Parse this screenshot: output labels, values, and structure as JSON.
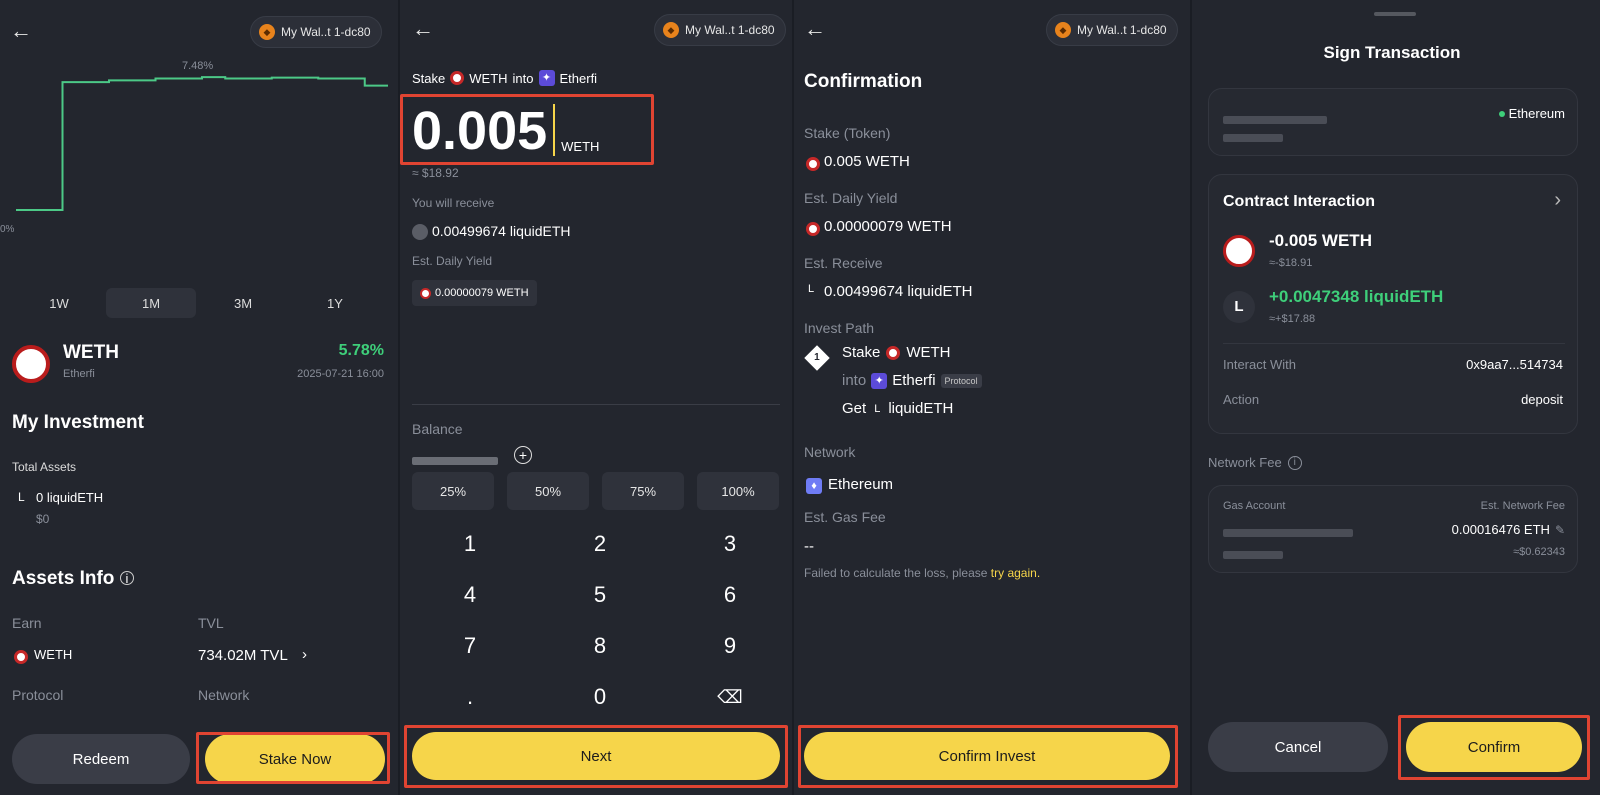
{
  "wallet_label": "My Wal..t 1-dc80",
  "p1": {
    "chart_peak_label": "7.48%",
    "chart_zero_label": "0%",
    "periods": [
      "1W",
      "1M",
      "3M",
      "1Y"
    ],
    "active_period": "1M",
    "token_name": "WETH",
    "token_protocol": "Etherfi",
    "apy": "5.78%",
    "timestamp": "2025-07-21 16:00",
    "my_investment_title": "My Investment",
    "total_assets_label": "Total Assets",
    "total_assets_amount": "0 liquidETH",
    "total_assets_usd": "$0",
    "assets_info_title": "Assets Info",
    "earn_label": "Earn",
    "earn_value": "WETH",
    "tvl_label": "TVL",
    "tvl_value": "734.02M TVL",
    "protocol_label": "Protocol",
    "network_label": "Network",
    "redeem_button": "Redeem",
    "stake_now_button": "Stake Now",
    "chart_points": [
      0,
      0,
      7.2,
      7.2,
      7.3,
      7.3,
      7.4,
      7.4,
      7.48,
      7.4,
      7.4,
      7.45,
      7.45,
      7.4,
      7.4,
      7.0,
      7.0
    ]
  },
  "p2": {
    "stake_prefix": "Stake",
    "stake_token": "WETH",
    "stake_into": "into",
    "stake_protocol": "Etherfi",
    "amount": "0.005",
    "amount_unit": "WETH",
    "amount_usd": "≈ $18.92",
    "receive_label": "You will receive",
    "receive_value": "0.00499674 liquidETH",
    "yield_label": "Est. Daily Yield",
    "yield_value": "0.00000079 WETH",
    "balance_label": "Balance",
    "percent_buttons": [
      "25%",
      "50%",
      "75%",
      "100%"
    ],
    "keys": [
      "1",
      "2",
      "3",
      "4",
      "5",
      "6",
      "7",
      "8",
      "9",
      ".",
      "0"
    ],
    "next_button": "Next"
  },
  "p3": {
    "title": "Confirmation",
    "stake_label": "Stake (Token)",
    "stake_value": "0.005 WETH",
    "yield_label": "Est. Daily Yield",
    "yield_value": "0.00000079 WETH",
    "receive_label": "Est. Receive",
    "receive_value": "0.00499674 liquidETH",
    "path_label": "Invest Path",
    "path_step_number": "1",
    "path_stake": "Stake",
    "path_stake_token": "WETH",
    "path_into": "into",
    "path_protocol": "Etherfi",
    "path_protocol_tag": "Protocol",
    "path_get": "Get",
    "path_get_token": "liquidETH",
    "network_label": "Network",
    "network_value": "Ethereum",
    "gas_label": "Est. Gas Fee",
    "gas_value": "--",
    "error_text": "Failed to calculate the loss, please",
    "error_link": "try again.",
    "confirm_invest_button": "Confirm Invest"
  },
  "p4": {
    "title": "Sign Transaction",
    "network_badge": "Ethereum",
    "contract_title": "Contract Interaction",
    "send_amount": "-0.005 WETH",
    "send_usd": "≈-$18.91",
    "receive_amount": "+0.0047348 liquidETH",
    "receive_usd": "≈+$17.88",
    "interact_label": "Interact With",
    "interact_value": "0x9aa7...514734",
    "action_label": "Action",
    "action_value": "deposit",
    "fee_label": "Network Fee",
    "gas_account_label": "Gas Account",
    "est_fee_label": "Est. Network Fee",
    "est_fee_value": "0.00016476 ETH",
    "est_fee_usd": "≈$0.62343",
    "cancel_button": "Cancel",
    "confirm_button": "Confirm"
  },
  "colors": {
    "accent_yellow": "#f6d54a",
    "positive_green": "#3ecf7a",
    "highlight_red": "#e04432",
    "panel_bg": "#23262e"
  }
}
